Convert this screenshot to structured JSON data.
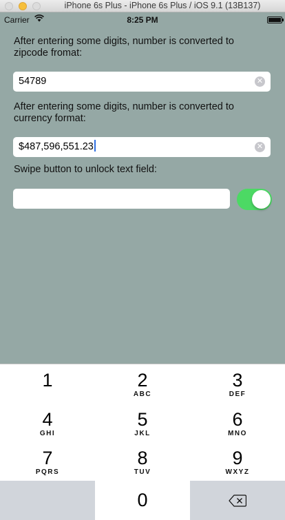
{
  "window": {
    "title": "iPhone 6s Plus - iPhone 6s Plus / iOS 9.1 (13B137)"
  },
  "status_bar": {
    "carrier": "Carrier",
    "time": "8:25 PM",
    "battery_level": 1.0
  },
  "form": {
    "zip_label": "After entering some digits, number is converted to zipcode fromat:",
    "zip_value": "54789",
    "currency_label": "After entering some digits, number is converted to currency format:",
    "currency_value": "$487,596,551.23",
    "unlock_label": "Swipe button to unlock text field:",
    "unlock_value": "",
    "unlock_switch_on": true
  },
  "keypad": {
    "keys": [
      {
        "digit": "1",
        "letters": ""
      },
      {
        "digit": "2",
        "letters": "ABC"
      },
      {
        "digit": "3",
        "letters": "DEF"
      },
      {
        "digit": "4",
        "letters": "GHI"
      },
      {
        "digit": "5",
        "letters": "JKL"
      },
      {
        "digit": "6",
        "letters": "MNO"
      },
      {
        "digit": "7",
        "letters": "PQRS"
      },
      {
        "digit": "8",
        "letters": "TUV"
      },
      {
        "digit": "9",
        "letters": "WXYZ"
      },
      {
        "digit": "0",
        "letters": ""
      }
    ]
  },
  "colors": {
    "screen_bg": "#95a8a5",
    "switch_on": "#4cd964",
    "key_gray": "#d1d5db"
  }
}
